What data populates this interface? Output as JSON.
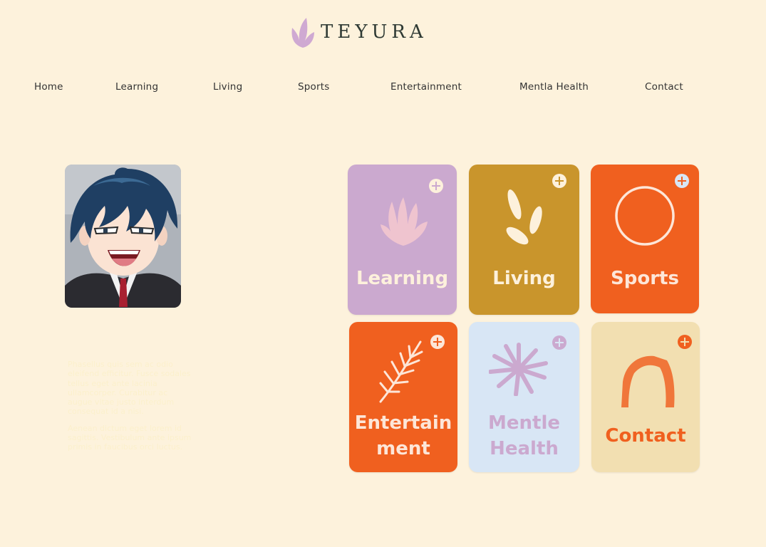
{
  "brand": {
    "name": "TEYURA",
    "accent": "#cfa9d2"
  },
  "nav": {
    "items": [
      {
        "label": "Home"
      },
      {
        "label": "Learning"
      },
      {
        "label": "Living"
      },
      {
        "label": "Sports"
      },
      {
        "label": "Entertainment"
      },
      {
        "label": "Mentla Health"
      },
      {
        "label": "Contact"
      }
    ]
  },
  "profile": {
    "bio": [
      "Phasellus quis sem ac odio eleifend efficitur. Fusce sodales tellus eget ante lacinia ullamcorper. Curabitur ac augue vitae justo interdum consequat id a nisi.",
      "Aenean dictum eget lorem id sagittis. Vestibulum ante ipsum primis in faucibus orci luctus."
    ]
  },
  "cards": [
    {
      "label": "Learning",
      "bg": "#cba9cf",
      "text_color": "#fdf1dc",
      "icon": "fan-leaf-icon"
    },
    {
      "label": "Living",
      "bg": "#c9952c",
      "text_color": "#fdf1dc",
      "icon": "leaves-icon"
    },
    {
      "label": "Sports",
      "bg": "#f0601f",
      "text_color": "#fde6d8",
      "icon": "circle-icon"
    },
    {
      "label": "Entertainment",
      "label_line1": "Entertain",
      "label_line2": "ment",
      "bg": "#f0601f",
      "text_color": "#fde6d8",
      "icon": "fern-icon"
    },
    {
      "label": "Mentle Health",
      "label_line1": "Mentle",
      "label_line2": "Health",
      "bg": "#d8e6f5",
      "text_color": "#cba9cf",
      "icon": "burst-icon"
    },
    {
      "label": "Contact",
      "bg": "#f2dfb1",
      "text_color": "#f0601f",
      "icon": "arch-icon"
    }
  ]
}
